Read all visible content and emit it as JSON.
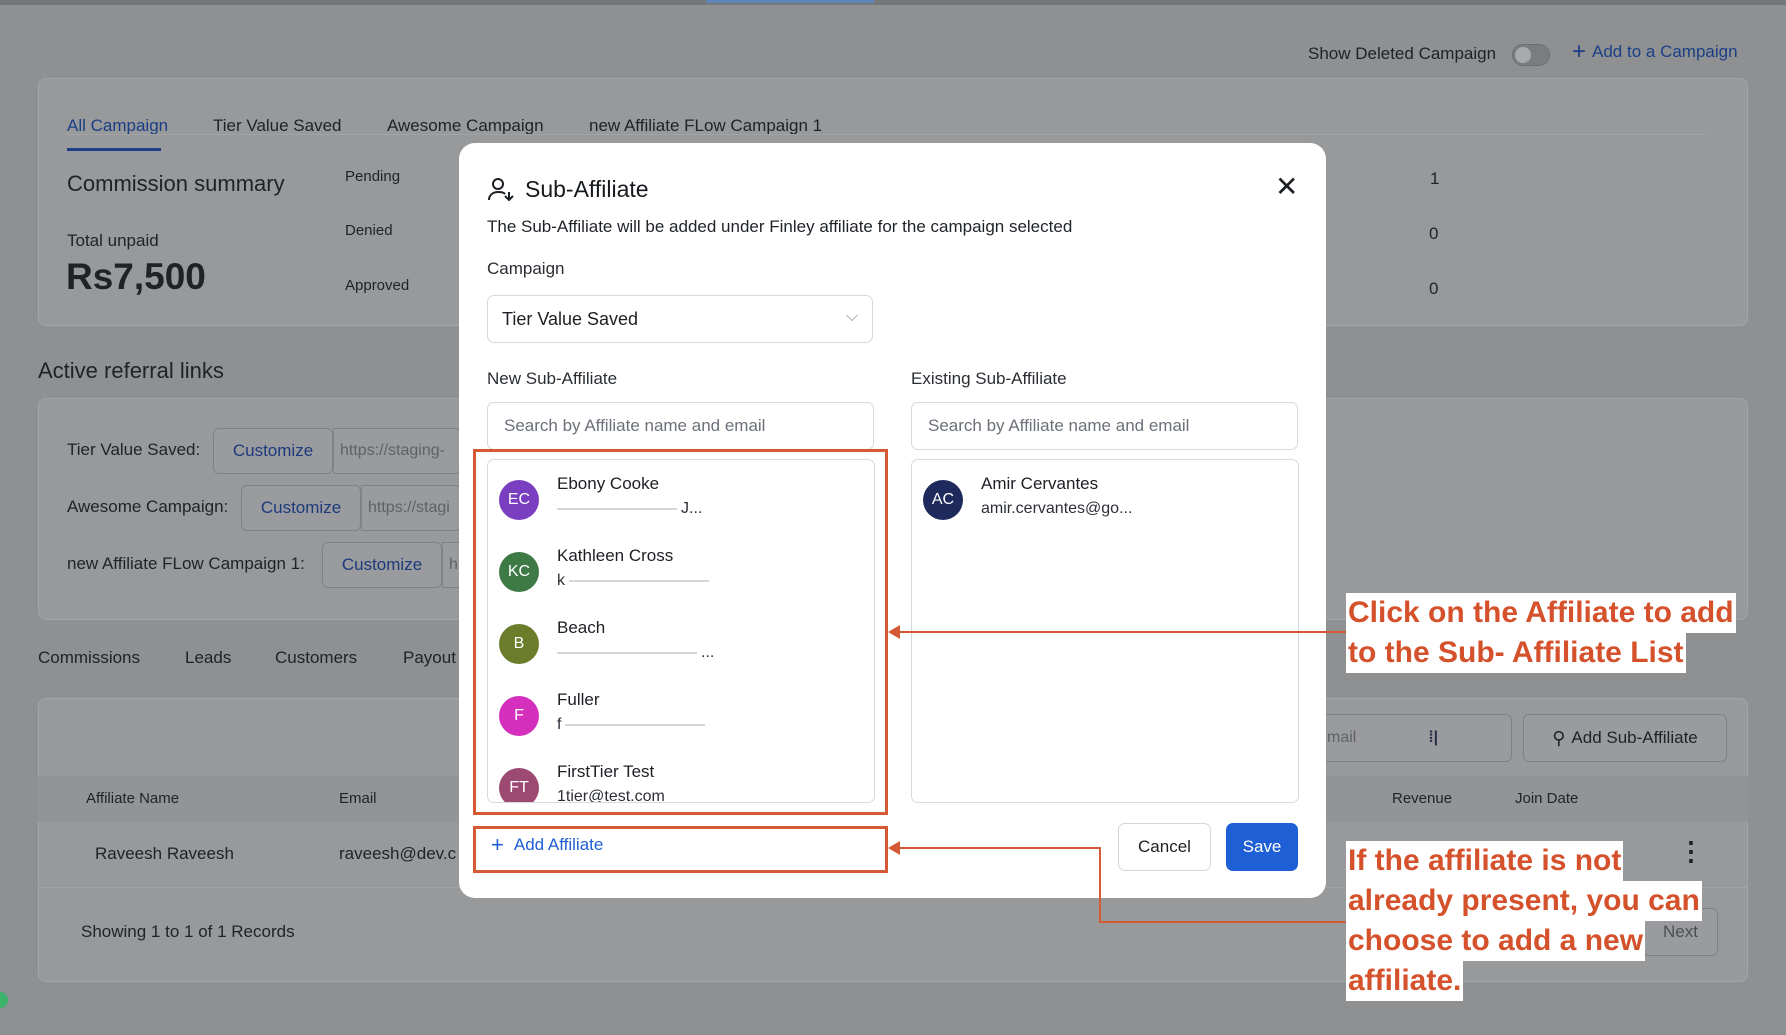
{
  "header": {
    "show_deleted_label": "Show Deleted Campaign",
    "add_campaign_label": "Add to a Campaign"
  },
  "campaign_tabs": [
    "All Campaign",
    "Tier Value Saved",
    "Awesome Campaign",
    "new Affiliate FLow Campaign 1"
  ],
  "summary": {
    "title": "Commission summary",
    "total_unpaid_label": "Total unpaid",
    "total_unpaid_value": "Rs7,500",
    "rows": [
      {
        "label": "Pending",
        "count": "1"
      },
      {
        "label": "Denied",
        "count": "0"
      },
      {
        "label": "Approved",
        "count": "0"
      }
    ]
  },
  "referral": {
    "title": "Active referral links",
    "customize_label": "Customize",
    "rows": [
      {
        "label": "Tier Value Saved:",
        "url": "https://staging-"
      },
      {
        "label": "Awesome Campaign:",
        "url": "https://stagi"
      },
      {
        "label": "new Affiliate FLow Campaign 1:",
        "url": "h"
      }
    ]
  },
  "bottom_tabs": [
    "Commissions",
    "Leads",
    "Customers",
    "Payout"
  ],
  "table": {
    "search_suffix": "mail",
    "add_sub_affiliate_label": "Add Sub-Affiliate",
    "columns": [
      "Affiliate Name",
      "Email",
      "Revenue",
      "Join Date"
    ],
    "row": {
      "name": "Raveesh Raveesh",
      "email": "raveesh@dev.c"
    },
    "records_text": "Showing 1 to 1 of 1 Records",
    "next_label": "Next"
  },
  "modal": {
    "title": "Sub-Affiliate",
    "subtitle": "The Sub-Affiliate will be added under Finley affiliate for the campaign selected",
    "campaign_label": "Campaign",
    "campaign_value": "Tier Value Saved",
    "new_label": "New Sub-Affiliate",
    "existing_label": "Existing Sub-Affiliate",
    "search_placeholder": "Search by Affiliate name and email",
    "new_list": [
      {
        "initials": "EC",
        "name": "Ebony Cooke",
        "email_prefix": "",
        "email_suffix": "J...",
        "color": "#7a3fc0"
      },
      {
        "initials": "KC",
        "name": "Kathleen Cross",
        "email_prefix": "k",
        "email_suffix": "",
        "color": "#3e7a46"
      },
      {
        "initials": "B",
        "name": "Beach",
        "email_prefix": "",
        "email_suffix": "...",
        "color": "#6b7d2a"
      },
      {
        "initials": "F",
        "name": "Fuller",
        "email_prefix": "f",
        "email_suffix": "",
        "color": "#d42fbd"
      },
      {
        "initials": "FT",
        "name": "FirstTier Test",
        "email_prefix": "1tier@test.com",
        "email_suffix": "",
        "color": "#9c4a72"
      }
    ],
    "existing_list": [
      {
        "initials": "AC",
        "name": "Amir Cervantes",
        "email": "amir.cervantes@go...",
        "color": "#1f2a5c"
      }
    ],
    "add_affiliate_label": "Add Affiliate",
    "cancel_label": "Cancel",
    "save_label": "Save"
  },
  "annotations": {
    "note1_line1": "Click on the Affiliate to add",
    "note1_line2": "to the Sub- Affiliate List",
    "note2_lines": [
      "If the affiliate is not",
      "already present, you can",
      "choose to add a new",
      "affiliate."
    ]
  },
  "colors": {
    "accent": "#1f5fd6",
    "annotation": "#d45a33",
    "overlay": "#8f9092"
  }
}
